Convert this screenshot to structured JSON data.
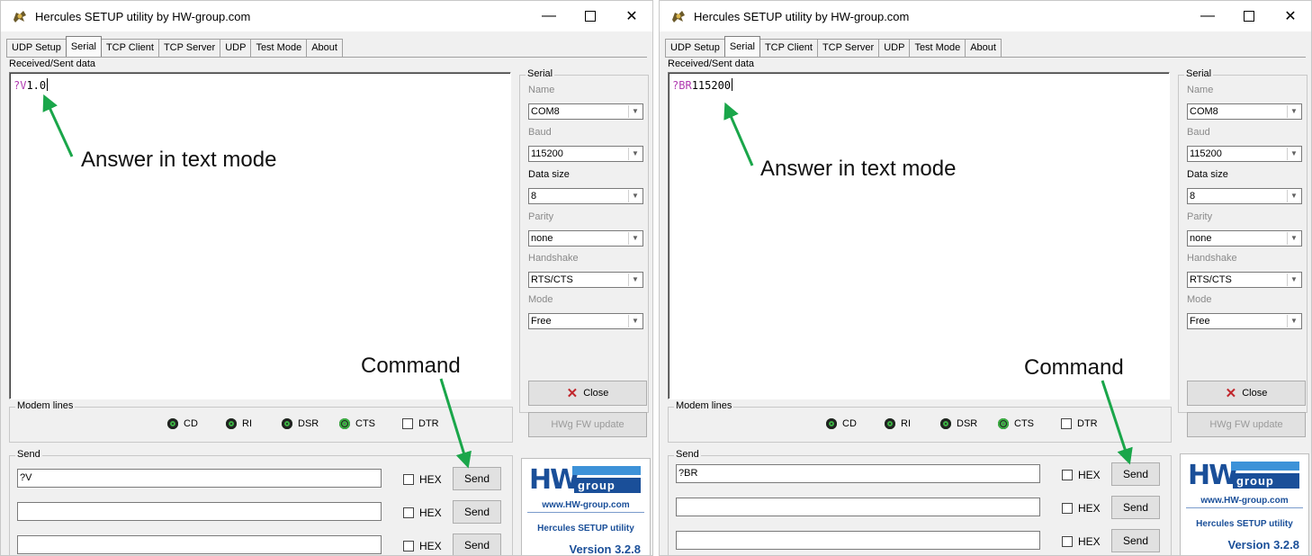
{
  "app": {
    "title": "Hercules SETUP utility by HW-group.com",
    "minimize": "—",
    "close": "✕"
  },
  "tabs": [
    "UDP Setup",
    "Serial",
    "TCP Client",
    "TCP Server",
    "UDP",
    "Test Mode",
    "About"
  ],
  "active_tab": "Serial",
  "received_label": "Received/Sent data",
  "serial": {
    "group_title": "Serial",
    "name_label": "Name",
    "name_value": "COM8",
    "baud_label": "Baud",
    "baud_value": "115200",
    "datasize_label": "Data size",
    "datasize_value": "8",
    "parity_label": "Parity",
    "parity_value": "none",
    "handshake_label": "Handshake",
    "handshake_value": "RTS/CTS",
    "mode_label": "Mode",
    "mode_value": "Free"
  },
  "buttons": {
    "close": "Close",
    "fw_update": "HWg FW update",
    "send": "Send"
  },
  "modem": {
    "title": "Modem lines",
    "cd": "CD",
    "ri": "RI",
    "dsr": "DSR",
    "cts": "CTS",
    "dtr": "DTR"
  },
  "send_group": {
    "title": "Send",
    "hex": "HEX"
  },
  "logo": {
    "hw": "HW",
    "group": "group",
    "url": "www.HW-group.com",
    "name": "Hercules SETUP utility",
    "version": "Version  3.2.8"
  },
  "annotations": {
    "answer": "Answer in text mode",
    "command": "Command"
  },
  "colors": {
    "received_cmd": "#b13cb1",
    "arrow": "#1aa64a",
    "logo_blue": "#1a4f99"
  },
  "left": {
    "received_cmd": "?V",
    "received_value": "1.0",
    "send_inputs": [
      "?V",
      "",
      ""
    ]
  },
  "right": {
    "received_cmd": "?BR",
    "received_value": "115200",
    "send_inputs": [
      "?BR",
      "",
      ""
    ]
  }
}
